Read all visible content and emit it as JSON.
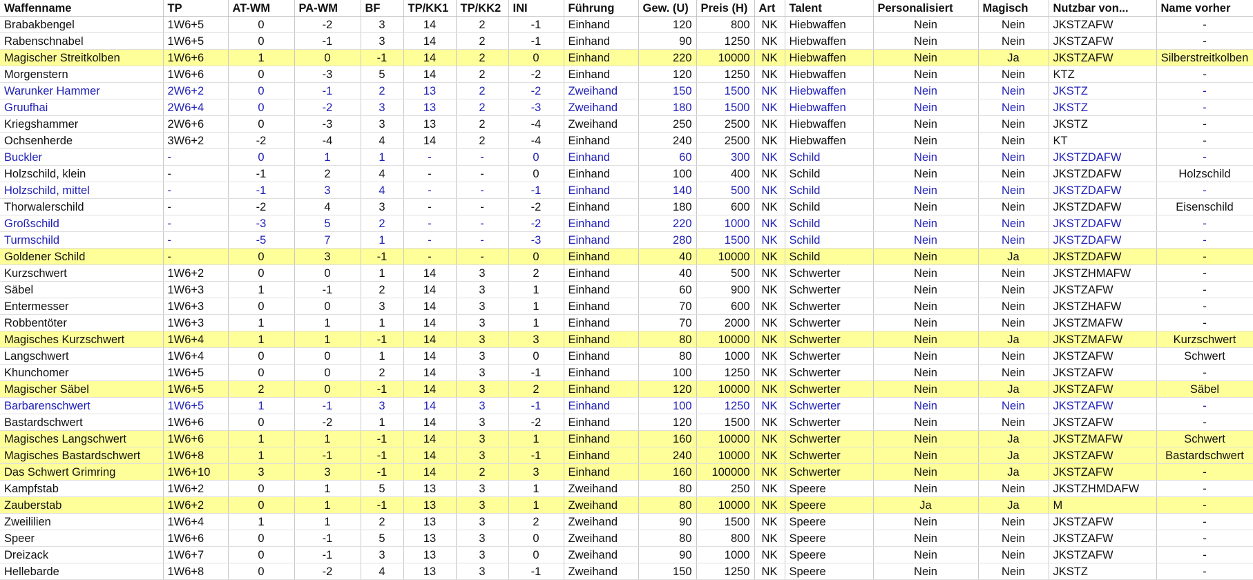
{
  "columns": [
    {
      "key": "name",
      "label": "Waffenname",
      "align": "l",
      "width": 236
    },
    {
      "key": "tp",
      "label": "TP",
      "align": "l",
      "width": 94
    },
    {
      "key": "at",
      "label": "AT-WM",
      "align": "c",
      "width": 96
    },
    {
      "key": "pa",
      "label": "PA-WM",
      "align": "c",
      "width": 96
    },
    {
      "key": "bf",
      "label": "BF",
      "align": "c",
      "width": 62
    },
    {
      "key": "tpkk1",
      "label": "TP/KK1",
      "align": "c",
      "width": 76
    },
    {
      "key": "tpkk2",
      "label": "TP/KK2",
      "align": "c",
      "width": 76
    },
    {
      "key": "ini",
      "label": "INI",
      "align": "c",
      "width": 80
    },
    {
      "key": "fuehrung",
      "label": "Führung",
      "align": "l",
      "width": 108
    },
    {
      "key": "gew",
      "label": "Gew. (U)",
      "align": "r",
      "width": 84
    },
    {
      "key": "preis",
      "label": "Preis (H)",
      "align": "r",
      "width": 84
    },
    {
      "key": "art",
      "label": "Art",
      "align": "c",
      "width": 44
    },
    {
      "key": "talent",
      "label": "Talent",
      "align": "l",
      "width": 128
    },
    {
      "key": "pers",
      "label": "Personalisiert",
      "align": "c",
      "width": 152
    },
    {
      "key": "magisch",
      "label": "Magisch",
      "align": "c",
      "width": 102
    },
    {
      "key": "nutzbar",
      "label": "Nutzbar von...",
      "align": "l",
      "width": 156
    },
    {
      "key": "vorher",
      "label": "Name vorher",
      "align": "c",
      "width": 140
    }
  ],
  "rows": [
    {
      "style": "",
      "cells": [
        "Brabakbengel",
        "1W6+5",
        "0",
        "-2",
        "3",
        "14",
        "2",
        "-1",
        "Einhand",
        "120",
        "800",
        "NK",
        "Hiebwaffen",
        "Nein",
        "Nein",
        "JKSTZAFW",
        "-"
      ]
    },
    {
      "style": "",
      "cells": [
        "Rabenschnabel",
        "1W6+5",
        "0",
        "-1",
        "3",
        "14",
        "2",
        "-1",
        "Einhand",
        "90",
        "1250",
        "NK",
        "Hiebwaffen",
        "Nein",
        "Nein",
        "JKSTZAFW",
        "-"
      ]
    },
    {
      "style": "hl",
      "cells": [
        "Magischer Streitkolben",
        "1W6+6",
        "1",
        "0",
        "-1",
        "14",
        "2",
        "0",
        "Einhand",
        "220",
        "10000",
        "NK",
        "Hiebwaffen",
        "Nein",
        "Ja",
        "JKSTZAFW",
        "Silberstreitkolben"
      ]
    },
    {
      "style": "",
      "cells": [
        "Morgenstern",
        "1W6+6",
        "0",
        "-3",
        "5",
        "14",
        "2",
        "-2",
        "Einhand",
        "120",
        "1250",
        "NK",
        "Hiebwaffen",
        "Nein",
        "Nein",
        "KTZ",
        "-"
      ]
    },
    {
      "style": "bl",
      "cells": [
        "Warunker Hammer",
        "2W6+2",
        "0",
        "-1",
        "2",
        "13",
        "2",
        "-2",
        "Zweihand",
        "150",
        "1500",
        "NK",
        "Hiebwaffen",
        "Nein",
        "Nein",
        "JKSTZ",
        "-"
      ]
    },
    {
      "style": "bl",
      "cells": [
        "Gruufhai",
        "2W6+4",
        "0",
        "-2",
        "3",
        "13",
        "2",
        "-3",
        "Zweihand",
        "180",
        "1500",
        "NK",
        "Hiebwaffen",
        "Nein",
        "Nein",
        "JKSTZ",
        "-"
      ]
    },
    {
      "style": "",
      "cells": [
        "Kriegshammer",
        "2W6+6",
        "0",
        "-3",
        "3",
        "13",
        "2",
        "-4",
        "Zweihand",
        "250",
        "2500",
        "NK",
        "Hiebwaffen",
        "Nein",
        "Nein",
        "JKSTZ",
        "-"
      ]
    },
    {
      "style": "",
      "cells": [
        "Ochsenherde",
        "3W6+2",
        "-2",
        "-4",
        "4",
        "14",
        "2",
        "-4",
        "Einhand",
        "240",
        "2500",
        "NK",
        "Hiebwaffen",
        "Nein",
        "Nein",
        "KT",
        "-"
      ]
    },
    {
      "style": "bl",
      "cells": [
        "Buckler",
        "-",
        "0",
        "1",
        "1",
        "-",
        "-",
        "0",
        "Einhand",
        "60",
        "300",
        "NK",
        "Schild",
        "Nein",
        "Nein",
        "JKSTZDAFW",
        "-"
      ]
    },
    {
      "style": "",
      "cells": [
        "Holzschild, klein",
        "-",
        "-1",
        "2",
        "4",
        "-",
        "-",
        "0",
        "Einhand",
        "100",
        "400",
        "NK",
        "Schild",
        "Nein",
        "Nein",
        "JKSTZDAFW",
        "Holzschild"
      ]
    },
    {
      "style": "bl",
      "cells": [
        "Holzschild, mittel",
        "-",
        "-1",
        "3",
        "4",
        "-",
        "-",
        "-1",
        "Einhand",
        "140",
        "500",
        "NK",
        "Schild",
        "Nein",
        "Nein",
        "JKSTZDAFW",
        "-"
      ]
    },
    {
      "style": "",
      "cells": [
        "Thorwalerschild",
        "-",
        "-2",
        "4",
        "3",
        "-",
        "-",
        "-2",
        "Einhand",
        "180",
        "600",
        "NK",
        "Schild",
        "Nein",
        "Nein",
        "JKSTZDAFW",
        "Eisenschild"
      ]
    },
    {
      "style": "bl",
      "cells": [
        "Großschild",
        "-",
        "-3",
        "5",
        "2",
        "-",
        "-",
        "-2",
        "Einhand",
        "220",
        "1000",
        "NK",
        "Schild",
        "Nein",
        "Nein",
        "JKSTZDAFW",
        "-"
      ]
    },
    {
      "style": "bl",
      "cells": [
        "Turmschild",
        "-",
        "-5",
        "7",
        "1",
        "-",
        "-",
        "-3",
        "Einhand",
        "280",
        "1500",
        "NK",
        "Schild",
        "Nein",
        "Nein",
        "JKSTZDAFW",
        "-"
      ]
    },
    {
      "style": "hl",
      "cells": [
        "Goldener Schild",
        "-",
        "0",
        "3",
        "-1",
        "-",
        "-",
        "0",
        "Einhand",
        "40",
        "10000",
        "NK",
        "Schild",
        "Nein",
        "Ja",
        "JKSTZDAFW",
        "-"
      ]
    },
    {
      "style": "",
      "cells": [
        "Kurzschwert",
        "1W6+2",
        "0",
        "0",
        "1",
        "14",
        "3",
        "2",
        "Einhand",
        "40",
        "500",
        "NK",
        "Schwerter",
        "Nein",
        "Nein",
        "JKSTZHMAFW",
        "-"
      ]
    },
    {
      "style": "",
      "cells": [
        "Säbel",
        "1W6+3",
        "1",
        "-1",
        "2",
        "14",
        "3",
        "1",
        "Einhand",
        "60",
        "900",
        "NK",
        "Schwerter",
        "Nein",
        "Nein",
        "JKSTZAFW",
        "-"
      ]
    },
    {
      "style": "",
      "cells": [
        "Entermesser",
        "1W6+3",
        "0",
        "0",
        "3",
        "14",
        "3",
        "1",
        "Einhand",
        "70",
        "600",
        "NK",
        "Schwerter",
        "Nein",
        "Nein",
        "JKSTZHAFW",
        "-"
      ]
    },
    {
      "style": "",
      "cells": [
        "Robbentöter",
        "1W6+3",
        "1",
        "1",
        "1",
        "14",
        "3",
        "1",
        "Einhand",
        "70",
        "2000",
        "NK",
        "Schwerter",
        "Nein",
        "Nein",
        "JKSTZMAFW",
        "-"
      ]
    },
    {
      "style": "hl",
      "cells": [
        "Magisches Kurzschwert",
        "1W6+4",
        "1",
        "1",
        "-1",
        "14",
        "3",
        "3",
        "Einhand",
        "80",
        "10000",
        "NK",
        "Schwerter",
        "Nein",
        "Ja",
        "JKSTZMAFW",
        "Kurzschwert"
      ]
    },
    {
      "style": "",
      "cells": [
        "Langschwert",
        "1W6+4",
        "0",
        "0",
        "1",
        "14",
        "3",
        "0",
        "Einhand",
        "80",
        "1000",
        "NK",
        "Schwerter",
        "Nein",
        "Nein",
        "JKSTZAFW",
        "Schwert"
      ]
    },
    {
      "style": "",
      "cells": [
        "Khunchomer",
        "1W6+5",
        "0",
        "0",
        "2",
        "14",
        "3",
        "-1",
        "Einhand",
        "100",
        "1250",
        "NK",
        "Schwerter",
        "Nein",
        "Nein",
        "JKSTZAFW",
        "-"
      ]
    },
    {
      "style": "hl",
      "cells": [
        "Magischer Säbel",
        "1W6+5",
        "2",
        "0",
        "-1",
        "14",
        "3",
        "2",
        "Einhand",
        "120",
        "10000",
        "NK",
        "Schwerter",
        "Nein",
        "Ja",
        "JKSTZAFW",
        "Säbel"
      ]
    },
    {
      "style": "bl",
      "cells": [
        "Barbarenschwert",
        "1W6+5",
        "1",
        "-1",
        "3",
        "14",
        "3",
        "-1",
        "Einhand",
        "100",
        "1250",
        "NK",
        "Schwerter",
        "Nein",
        "Nein",
        "JKSTZAFW",
        "-"
      ]
    },
    {
      "style": "",
      "cells": [
        "Bastardschwert",
        "1W6+6",
        "0",
        "-2",
        "1",
        "14",
        "3",
        "-2",
        "Einhand",
        "120",
        "1500",
        "NK",
        "Schwerter",
        "Nein",
        "Nein",
        "JKSTZAFW",
        "-"
      ]
    },
    {
      "style": "hl",
      "cells": [
        "Magisches Langschwert",
        "1W6+6",
        "1",
        "1",
        "-1",
        "14",
        "3",
        "1",
        "Einhand",
        "160",
        "10000",
        "NK",
        "Schwerter",
        "Nein",
        "Ja",
        "JKSTZMAFW",
        "Schwert"
      ]
    },
    {
      "style": "hl",
      "cells": [
        "Magisches Bastardschwert",
        "1W6+8",
        "1",
        "-1",
        "-1",
        "14",
        "3",
        "-1",
        "Einhand",
        "240",
        "10000",
        "NK",
        "Schwerter",
        "Nein",
        "Ja",
        "JKSTZAFW",
        "Bastardschwert"
      ]
    },
    {
      "style": "hl",
      "cells": [
        "Das Schwert Grimring",
        "1W6+10",
        "3",
        "3",
        "-1",
        "14",
        "2",
        "3",
        "Einhand",
        "160",
        "100000",
        "NK",
        "Schwerter",
        "Nein",
        "Ja",
        "JKSTZAFW",
        "-"
      ]
    },
    {
      "style": "",
      "cells": [
        "Kampfstab",
        "1W6+2",
        "0",
        "1",
        "5",
        "13",
        "3",
        "1",
        "Zweihand",
        "80",
        "250",
        "NK",
        "Speere",
        "Nein",
        "Nein",
        "JKSTZHMDAFW",
        "-"
      ]
    },
    {
      "style": "hl",
      "cells": [
        "Zauberstab",
        "1W6+2",
        "0",
        "1",
        "-1",
        "13",
        "3",
        "1",
        "Zweihand",
        "80",
        "10000",
        "NK",
        "Speere",
        "Ja",
        "Ja",
        "M",
        "-"
      ]
    },
    {
      "style": "",
      "cells": [
        "Zweililien",
        "1W6+4",
        "1",
        "1",
        "2",
        "13",
        "3",
        "2",
        "Zweihand",
        "90",
        "1500",
        "NK",
        "Speere",
        "Nein",
        "Nein",
        "JKSTZAFW",
        "-"
      ]
    },
    {
      "style": "",
      "cells": [
        "Speer",
        "1W6+6",
        "0",
        "-1",
        "5",
        "13",
        "3",
        "0",
        "Zweihand",
        "80",
        "800",
        "NK",
        "Speere",
        "Nein",
        "Nein",
        "JKSTZAFW",
        "-"
      ]
    },
    {
      "style": "",
      "cells": [
        "Dreizack",
        "1W6+7",
        "0",
        "-1",
        "3",
        "13",
        "3",
        "0",
        "Zweihand",
        "90",
        "1000",
        "NK",
        "Speere",
        "Nein",
        "Nein",
        "JKSTZAFW",
        "-"
      ]
    },
    {
      "style": "",
      "cells": [
        "Hellebarde",
        "1W6+8",
        "0",
        "-2",
        "4",
        "13",
        "3",
        "-1",
        "Zweihand",
        "150",
        "1250",
        "NK",
        "Speere",
        "Nein",
        "Nein",
        "JKSTZ",
        "-"
      ]
    }
  ]
}
